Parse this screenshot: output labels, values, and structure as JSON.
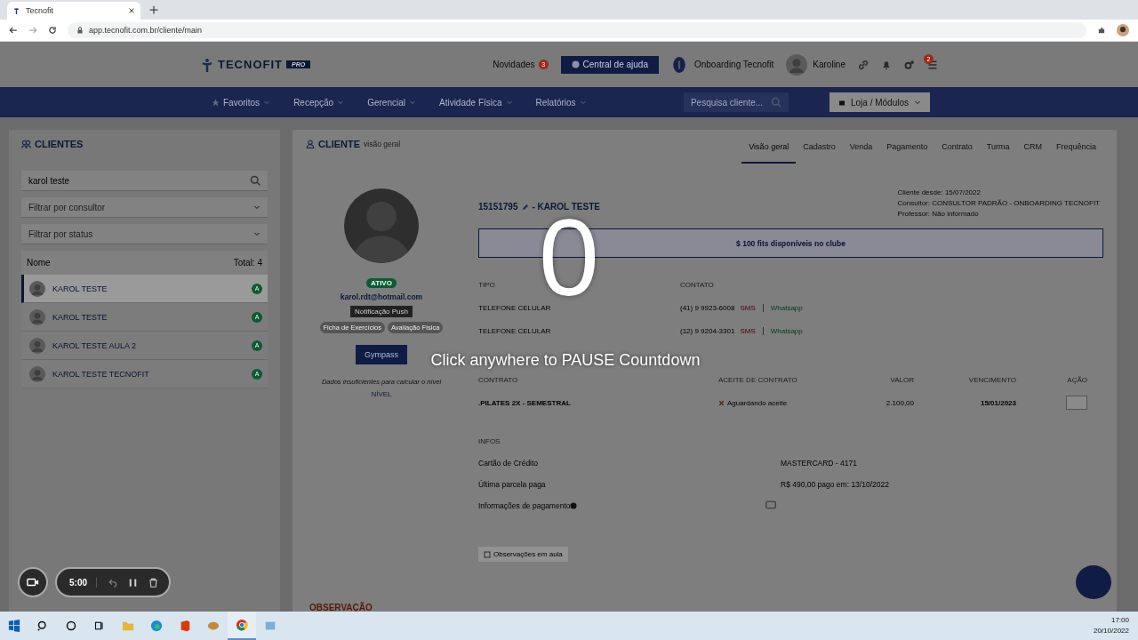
{
  "browser": {
    "tab_title": "Tecnofit",
    "url": "app.tecnofit.com.br/cliente/main"
  },
  "header": {
    "logo": "TECNOFIT",
    "logo_badge": "PRO",
    "news": {
      "label": "Novidades",
      "count": "3"
    },
    "help_button": "Central de ajuda",
    "onboarding": "Onboarding Tecnofit",
    "user": "Karoline",
    "menu_badge": "2"
  },
  "nav": {
    "items": [
      "Favoritos",
      "Recepção",
      "Gerencial",
      "Atividade Física",
      "Relatórios"
    ],
    "search_placeholder": "Pesquisa cliente...",
    "store_button": "Loja / Módulos"
  },
  "clients": {
    "title": "CLIENTES",
    "search_value": "karol teste",
    "filters": [
      "Filtrar por consultor",
      "Filtrar por status"
    ],
    "column": "Nome",
    "total": "Total: 4",
    "rows": [
      {
        "name": "KAROL TESTE",
        "status": "A",
        "selected": true
      },
      {
        "name": "KAROL TESTE",
        "status": "A",
        "selected": false
      },
      {
        "name": "KAROL TESTE AULA 2",
        "status": "A",
        "selected": false
      },
      {
        "name": "KAROL TESTE TECNOFIT",
        "status": "A",
        "selected": false
      }
    ]
  },
  "client": {
    "title": "CLIENTE",
    "subtitle": "visão geral",
    "tabs": [
      {
        "label": "Visão geral",
        "selected": true
      },
      {
        "label": "Cadastro",
        "selected": false
      },
      {
        "label": "Venda",
        "selected": false
      },
      {
        "label": "Pagamento",
        "selected": false
      },
      {
        "label": "Contrato",
        "selected": false
      },
      {
        "label": "Turma",
        "selected": false
      },
      {
        "label": "CRM",
        "selected": false
      },
      {
        "label": "Frequência",
        "selected": false
      }
    ],
    "id": "15151795",
    "name": "- KAROL TESTE",
    "since": "Cliente desde: 15/07/2022",
    "consultant": "Consultor: CONSULTOR PADRÃO - ONBOARDING TECNOFIT",
    "teacher": "Professor: Não informado",
    "status": "ATIVO",
    "email": "karol.rdt@hotmail.com",
    "push": "Notificação Push",
    "tags": [
      "Ficha de Exercícios",
      "Avaliação Física"
    ],
    "gympass": "Gympass",
    "level_note": "Dados insuficientes para calcular o nível",
    "level_link": "NÍVEL",
    "fits": "$ 100 fits disponíveis no clube",
    "contacts": {
      "columns": [
        "TIPO",
        "CONTATO"
      ],
      "rows": [
        {
          "type": "TELEFONE CELULAR",
          "number": "(41) 9 9923-6008",
          "sms": "SMS",
          "whatsapp": "Whatsapp"
        },
        {
          "type": "TELEFONE CELULAR",
          "number": "(12) 9 9204-3301",
          "sms": "SMS",
          "whatsapp": "Whatsapp"
        }
      ]
    },
    "contracts": {
      "columns": [
        "CONTRATO",
        "ACEITE DE CONTRATO",
        "VALOR",
        "VENCIMENTO",
        "AÇÃO"
      ],
      "rows": [
        {
          "name": ".PILATES 2X - SEMESTRAL",
          "acceptance": "Aguardando aceite",
          "value": "2.100,00",
          "due": "15/01/2023"
        }
      ]
    },
    "infos": {
      "title": "INFOS",
      "items": [
        {
          "label": "Cartão de Crédito",
          "value": "MASTERCARD - 4171"
        },
        {
          "label": "Última parcela paga",
          "value": "R$ 490,00 pago em: 13/10/2022"
        }
      ],
      "payment_label": "Informações de pagamento"
    },
    "observations_button": "Observações em aula",
    "observation_title": "OBSERVAÇÃO"
  },
  "overlay": {
    "countdown": "0",
    "message": "Click anywhere to PAUSE Countdown",
    "timer": "5:00"
  },
  "taskbar": {
    "time": "17:00",
    "date": "20/10/2022"
  }
}
